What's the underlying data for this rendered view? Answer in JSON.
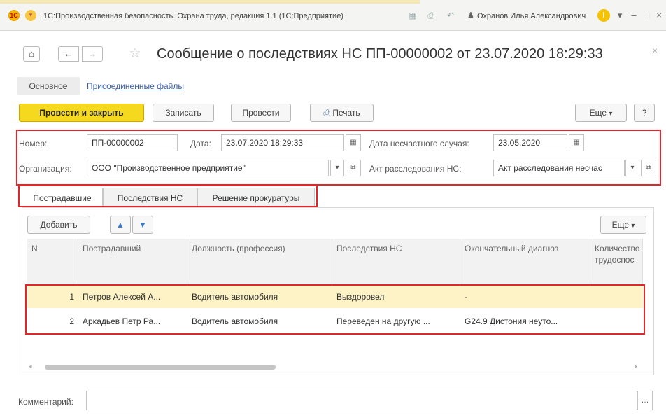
{
  "window": {
    "title": "1С:Производственная безопасность. Охрана труда, редакция 1.1  (1С:Предприятие)",
    "user": "Охранов Илья Александрович",
    "logo_text": "1С",
    "app_menu_icon": "chevron-down-icon",
    "controls": {
      "minimize": "–",
      "restore": "□",
      "close": "×"
    }
  },
  "document": {
    "title": "Сообщение о последствиях НС ПП-00000002 от 23.07.2020 18:29:33"
  },
  "section_tabs": {
    "main": "Основное",
    "files": "Присоединенные файлы"
  },
  "toolbar": {
    "post_and_close": "Провести и закрыть",
    "save": "Записать",
    "post": "Провести",
    "print": "Печать",
    "more": "Еще",
    "help": "?"
  },
  "header": {
    "number_label": "Номер:",
    "number_value": "ПП-00000002",
    "date_label": "Дата:",
    "date_value": "23.07.2020 18:29:33",
    "accident_date_label": "Дата несчастного случая:",
    "accident_date_value": "23.05.2020",
    "org_label": "Организация:",
    "org_value": "ООО \"Производственное предприятие\"",
    "act_label": "Акт расследования НС:",
    "act_value": "Акт расследования несчас"
  },
  "inner_tabs": [
    "Пострадавшие",
    "Последствия НС",
    "Решение прокуратуры"
  ],
  "table": {
    "add_button": "Добавить",
    "more_button": "Еще",
    "columns": [
      "N",
      "Пострадавший",
      "Должность (профессия)",
      "Последствия НС",
      "Окончательный диагноз",
      "Количество трудоспос"
    ],
    "rows": [
      {
        "n": "1",
        "victim": "Петров Алексей А...",
        "position": "Водитель автомобиля",
        "consequence": "Выздоровел",
        "diagnosis": "-",
        "days": ""
      },
      {
        "n": "2",
        "victim": "Аркадьев Петр Ра...",
        "position": "Водитель автомобиля",
        "consequence": "Переведен на другую ...",
        "diagnosis": "G24.9 Дистония неуто...",
        "days": ""
      }
    ]
  },
  "comment": {
    "label": "Комментарий:",
    "value": ""
  },
  "colors": {
    "accent_button": "#f5d91e",
    "annotation_frame": "#e0262b",
    "selected_row": "#fdf3c7",
    "link": "#3a5fa6"
  }
}
